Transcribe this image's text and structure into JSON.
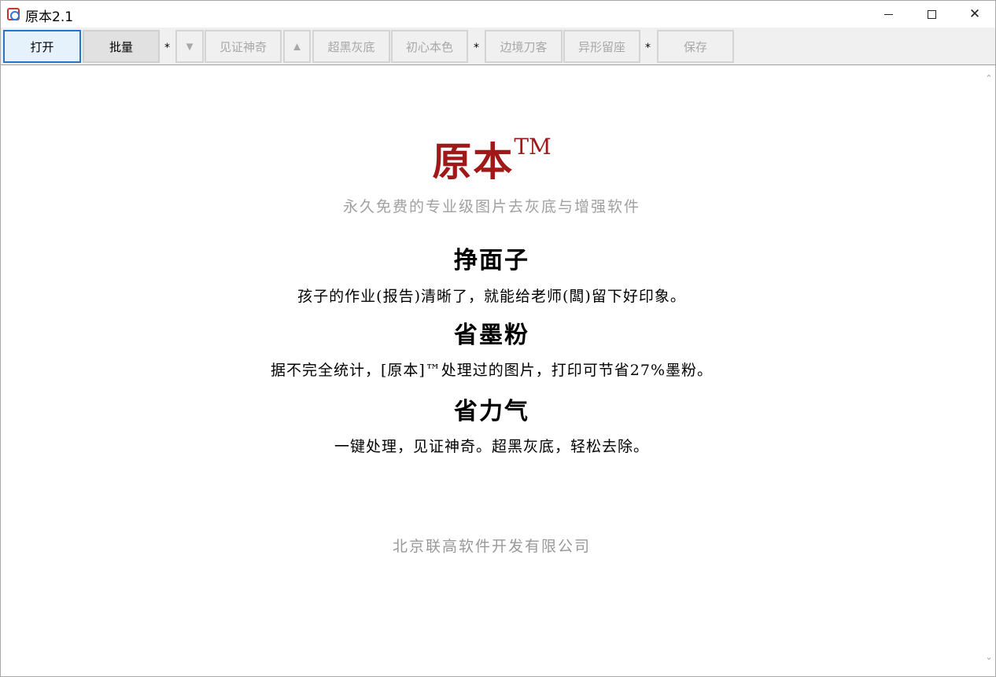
{
  "window": {
    "title": "原本2.1",
    "minimize_icon": "minimize-icon",
    "maximize_icon": "maximize-icon",
    "close_icon": "close-icon",
    "close_glyph": "✕"
  },
  "toolbar": {
    "open_label": "打开",
    "batch_label": "批量",
    "sep1": "*",
    "down_label": "▼",
    "magic_label": "见证神奇",
    "up_label": "▲",
    "super_black_label": "超黑灰底",
    "original_color_label": "初心本色",
    "sep2": "*",
    "border_label": "边境刀客",
    "odd_seat_label": "异形留座",
    "sep3": "*",
    "save_label": "保存"
  },
  "main": {
    "logo_text": "原本",
    "logo_tm": "TM",
    "tagline": "永久免费的专业级图片去灰底与增强软件",
    "sections": [
      {
        "heading": "挣面子",
        "text": "孩子的作业(报告)清晰了，就能给老师(闆)留下好印象。"
      },
      {
        "heading": "省墨粉",
        "text": "据不完全统计，[原本]™处理过的图片，打印可节省27%墨粉。"
      },
      {
        "heading": "省力气",
        "text": "一键处理，见证神奇。超黑灰底，轻松去除。"
      }
    ],
    "company": "北京联高软件开发有限公司"
  },
  "colors": {
    "logo_red": "#a01818",
    "accent_blue": "#2a74c4",
    "muted_gray": "#a0a0a0"
  }
}
